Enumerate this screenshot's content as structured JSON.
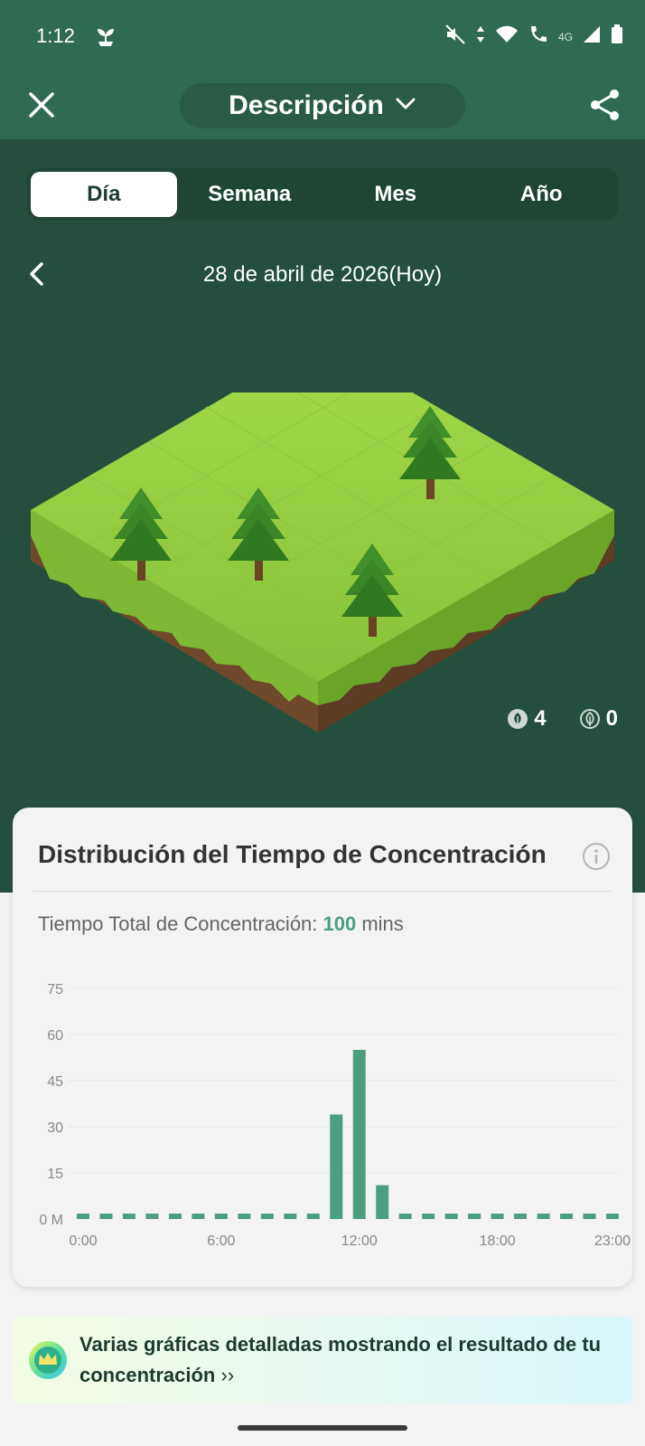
{
  "status": {
    "time": "1:12",
    "network": "4G"
  },
  "header": {
    "title": "Descripción"
  },
  "tabs": [
    {
      "label": "Día",
      "active": true
    },
    {
      "label": "Semana",
      "active": false
    },
    {
      "label": "Mes",
      "active": false
    },
    {
      "label": "Año",
      "active": false
    }
  ],
  "date": {
    "label": "28 de abril de 2026(Hoy)"
  },
  "forest": {
    "trees_alive": "4",
    "trees_dead": "0"
  },
  "card": {
    "title": "Distribución del Tiempo de Concentración",
    "total_prefix": "Tiempo Total de Concentración: ",
    "total_value": "100",
    "total_unit": " mins"
  },
  "chart_data": {
    "type": "bar",
    "categories": [
      "0:00",
      "1:00",
      "2:00",
      "3:00",
      "4:00",
      "5:00",
      "6:00",
      "7:00",
      "8:00",
      "9:00",
      "10:00",
      "11:00",
      "12:00",
      "13:00",
      "14:00",
      "15:00",
      "16:00",
      "17:00",
      "18:00",
      "19:00",
      "20:00",
      "21:00",
      "22:00",
      "23:00"
    ],
    "values": [
      0,
      0,
      0,
      0,
      0,
      0,
      0,
      0,
      0,
      0,
      0,
      34,
      55,
      11,
      0,
      0,
      0,
      0,
      0,
      0,
      0,
      0,
      0,
      0
    ],
    "ylim": [
      0,
      75
    ],
    "yticks": [
      {
        "v": 0,
        "label": "0 M"
      },
      {
        "v": 15,
        "label": "15"
      },
      {
        "v": 30,
        "label": "30"
      },
      {
        "v": 45,
        "label": "45"
      },
      {
        "v": 60,
        "label": "60"
      },
      {
        "v": 75,
        "label": "75"
      }
    ],
    "xticks": [
      {
        "i": 0,
        "label": "0:00"
      },
      {
        "i": 6,
        "label": "6:00"
      },
      {
        "i": 12,
        "label": "12:00"
      },
      {
        "i": 18,
        "label": "18:00"
      },
      {
        "i": 23,
        "label": "23:00"
      }
    ],
    "grid": true,
    "color": "#4d9e7f"
  },
  "promo": {
    "text": "Varias gráficas detalladas mostrando el resultado de tu concentración",
    "arrow": "››"
  },
  "colors": {
    "header_bg": "#2f6b53",
    "hero_bg": "#244f3e",
    "accent": "#4d9e7f"
  }
}
